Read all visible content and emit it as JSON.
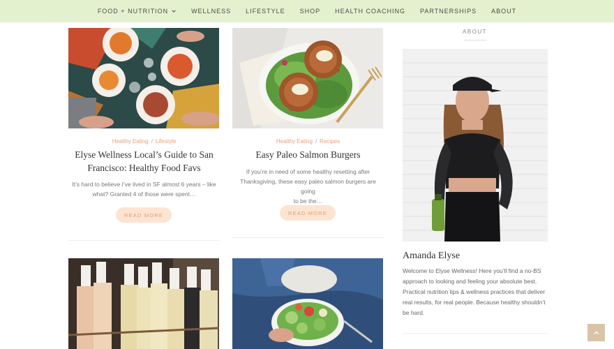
{
  "nav": {
    "items": [
      {
        "label": "FOOD + NUTRITION",
        "has_dropdown": true
      },
      {
        "label": "WELLNESS"
      },
      {
        "label": "LIFESTYLE"
      },
      {
        "label": "SHOP"
      },
      {
        "label": "HEALTH COACHING"
      },
      {
        "label": "PARTNERSHIPS"
      },
      {
        "label": "ABOUT"
      }
    ]
  },
  "posts": [
    {
      "categories": [
        "Healthy Eating",
        "Lifestyle"
      ],
      "title_line1": "Elyse Wellness Local’s Guide to San",
      "title_line2": "Francisco: Healthy Food Favs",
      "excerpt_line1": "It’s hard to believe I’ve lived in SF almost 6 years – like",
      "excerpt_line2": "what? Granted 4 of those were spent…",
      "button": "READ MORE"
    },
    {
      "categories": [
        "Healthy Eating",
        "Recipes"
      ],
      "title_line1": "Easy Paleo Salmon Burgers",
      "excerpt_line1": "If you’re in need of some healthy resetting after",
      "excerpt_line2": "Thanksgiving, these easy paleo salmon burgers are going",
      "excerpt_line3": "to be the…",
      "button": "READ MORE"
    }
  ],
  "sidebar": {
    "heading": "ABOUT",
    "name": "Amanda Elyse",
    "bio": "Welcome to Elyse Wellness! Here you’ll find a no-BS approach to looking and feeling your absolute best. Practical nutrition tips & wellness practices that deliver real results, for real people. Because healthy shouldn’t be hard."
  },
  "colors": {
    "nav_bg": "#e4f1cf",
    "category": "#e8a07a",
    "button_bg": "#fde4d1",
    "back_to_top": "#d9c4a8"
  },
  "icons": {
    "dropdown": "chevron-down-icon",
    "back_to_top": "chevron-up-icon"
  }
}
